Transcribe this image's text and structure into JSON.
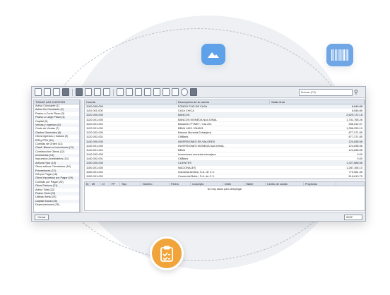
{
  "toolbar": {
    "search_placeholder": "Buscar (F3)"
  },
  "left_list": {
    "header": "TODAS LAS CUENTAS",
    "items": [
      "Activo Circulante (1)",
      "Activo No Circulante (2)",
      "Pasivo a Corto Plazo (3)",
      "Pasivo a Largo Plazo (4)",
      "Capital (5)",
      "Ventas y Ingresos (6)",
      "Costo de Ventas (7)",
      "Gastos Generales (8)",
      "Otros ingresos y Gastos (9)",
      "ISR y PTU (10)",
      "Cuentas de Orden (11)",
      "Clasif. Bienes e Inversiones (11)",
      "Construcción Obras (12)",
      "Inventarios (13)",
      "Impuestos Acreditables (14)",
      "Activos Fijos (15)",
      "Otros activos Circulantes (16)",
      "Proveedores (17)",
      "IVA por Pagar (18)",
      "Otros Impuestos por Pagar (19)",
      "Cuentas por Pagar (20)",
      "Otros Pasivos (21)",
      "Activo Total (22)",
      "Pasivo Total (23)",
      "Utilidad Neta (24)",
      "Capital Social (25)",
      "Depreciaciones (26)"
    ]
  },
  "main_grid": {
    "headers": [
      "Cuenta",
      "Descripción de la cuenta",
      "Saldo final"
    ],
    "rows": [
      {
        "account": "1100-000-000",
        "desc": "FONDO FIJO DE CAJA",
        "amount": "6,846.86",
        "group": true
      },
      {
        "account": "1110-001-000",
        "desc": "CAJA CHICA",
        "amount": "6,846.86",
        "group": false
      },
      {
        "account": "1120-000-000",
        "desc": "BANCOS",
        "amount": "2,629,172.18",
        "group": true
      },
      {
        "account": "1120-001-000",
        "desc": "BANCOS MONEDA NACIONAL",
        "amount": "1,751,765.26",
        "group": false
      },
      {
        "account": "1120-001-001",
        "desc": "Banamex PYME7 / Cta 201",
        "amount": "535,512.07",
        "group": false
      },
      {
        "account": "1120-001-002",
        "desc": "BBVA 1493 / 264821",
        "amount": "1,356,253.19",
        "group": false
      },
      {
        "account": "1120-002-000",
        "desc": "Bancos Moneda Extranjera",
        "amount": "877,371.85",
        "group": false
      },
      {
        "account": "1120-002-001",
        "desc": "CitiBank",
        "amount": "877,371.85",
        "group": false
      },
      {
        "account": "1140-000-000",
        "desc": "INVERSIONES EN VALORES",
        "amount": "124,838.56",
        "group": true
      },
      {
        "account": "1140-001-000",
        "desc": "INVERSIONES MONEDA NACIONAL",
        "amount": "124,838.56",
        "group": false
      },
      {
        "account": "1140-001-001",
        "desc": "BBVA",
        "amount": "124,838.56",
        "group": false
      },
      {
        "account": "1140-002-000",
        "desc": "Inversiones moneda extranjera",
        "amount": "0.00",
        "group": false
      },
      {
        "account": "1140-002-001",
        "desc": "CitiBank",
        "amount": "0.00",
        "group": false
      },
      {
        "account": "1150-000-000",
        "desc": "CLIENTES",
        "amount": "1,327,688.58",
        "group": true
      },
      {
        "account": "1150-001-000",
        "desc": "NACIONALES",
        "amount": "1,287,165.10",
        "group": false
      },
      {
        "account": "1150-001-001",
        "desc": "Industrial Andina, S.A. de C.V.",
        "amount": "770,551.35",
        "group": false
      },
      {
        "account": "1150-001-002",
        "desc": "Comercial Belén, S.A. de C.V.",
        "amount": "516,613.75",
        "group": false
      }
    ]
  },
  "detail_grid": {
    "headers": [
      "Ej",
      "Mt",
      "Cf",
      "FP",
      "Tipo",
      "Número",
      "Fecha",
      "Concepto",
      "Debe",
      "Haber",
      "Centro de costos",
      "Proyectos"
    ],
    "empty_text": "No hay datos para desplegar"
  },
  "status_bar": {
    "close_label": "Cerrar",
    "year": "2022"
  }
}
